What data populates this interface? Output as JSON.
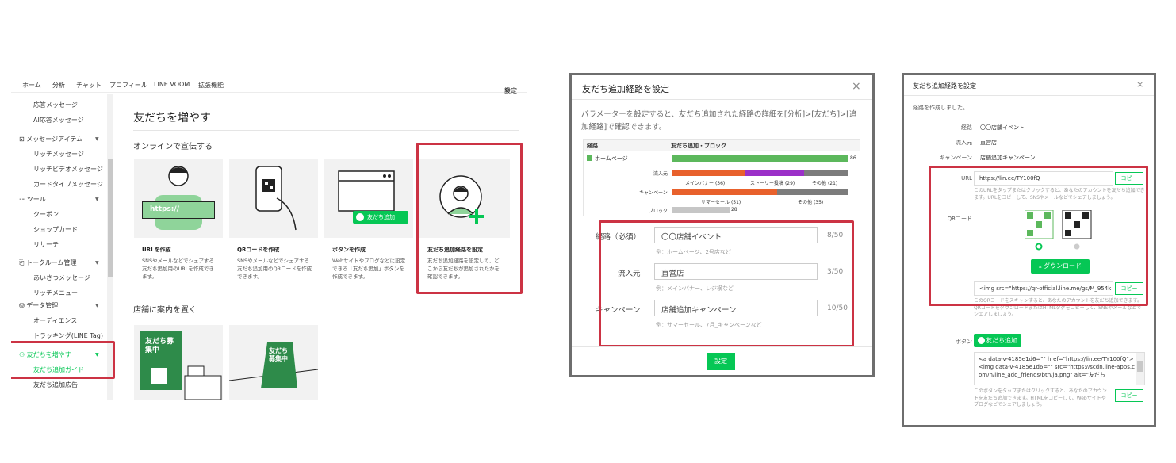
{
  "panel1": {
    "topnav": [
      "ホーム",
      "分析",
      "チャット",
      "プロフィール",
      "LINE VOOM",
      "拡張機能"
    ],
    "settings": "設定",
    "sidebar": {
      "items": [
        {
          "label": "応答メッセージ",
          "kind": "item"
        },
        {
          "label": "AI応答メッセージ",
          "kind": "item"
        },
        {
          "label": "メッセージアイテム",
          "kind": "group"
        },
        {
          "label": "リッチメッセージ",
          "kind": "item"
        },
        {
          "label": "リッチビデオメッセージ",
          "kind": "item"
        },
        {
          "label": "カードタイプメッセージ",
          "kind": "item"
        },
        {
          "label": "ツール",
          "kind": "group"
        },
        {
          "label": "クーポン",
          "kind": "item"
        },
        {
          "label": "ショップカード",
          "kind": "item"
        },
        {
          "label": "リサーチ",
          "kind": "item"
        },
        {
          "label": "トークルーム管理",
          "kind": "group"
        },
        {
          "label": "あいさつメッセージ",
          "kind": "item"
        },
        {
          "label": "リッチメニュー",
          "kind": "item"
        },
        {
          "label": "データ管理",
          "kind": "group"
        },
        {
          "label": "オーディエンス",
          "kind": "item"
        },
        {
          "label": "トラッキング(LINE Tag)",
          "kind": "item"
        },
        {
          "label": "友だちを増やす",
          "kind": "group-active"
        },
        {
          "label": "友だち追加ガイド",
          "kind": "item-active"
        },
        {
          "label": "友だち追加広告",
          "kind": "item"
        }
      ]
    },
    "page_title": "友だちを増やす",
    "section_online": "オンラインで宣伝する",
    "section_store": "店舗に案内を置く",
    "url_text": "https://",
    "add_friend_button": "友だち追加",
    "poster_text": "友だち募集中",
    "cards": [
      {
        "title": "URLを作成",
        "desc": "SNSやメールなどでシェアする友だち追加用のURLを作成できます。"
      },
      {
        "title": "QRコードを作成",
        "desc": "SNSやメールなどでシェアする友だち追加用のQRコードを作成できます。"
      },
      {
        "title": "ボタンを作成",
        "desc": "Webサイトやブログなどに設定できる「友だち追加」ボタンを作成できます。"
      },
      {
        "title": "友だち追加経路を設定",
        "desc": "友だち追加経路を設定して、どこから友だちが追加されたかを確認できます。"
      }
    ]
  },
  "panel2": {
    "title": "友だち追加経路を設定",
    "close_icon": "×",
    "description": "パラメーターを設定すると、友だち追加された経路の詳細を[分析]>[友だち]>[追加経路]で確認できます。",
    "chart_header": {
      "route": "経路",
      "metric": "友だち追加・ブロック"
    },
    "chart_rows": [
      {
        "label": "ホームページ",
        "value": "86"
      },
      {
        "label": "流入元",
        "segments": [
          {
            "name": "メインバナー",
            "value": "(36)"
          },
          {
            "name": "ストーリー投稿",
            "value": "(29)"
          },
          {
            "name": "その他",
            "value": "(21)"
          }
        ]
      },
      {
        "label": "キャンペーン",
        "segments": [
          {
            "name": "サマーセール",
            "value": "(51)"
          },
          {
            "name": "その他",
            "value": "(35)"
          }
        ]
      },
      {
        "label": "ブロック",
        "value": "28"
      }
    ],
    "colors": {
      "green": "#5cb85c",
      "orange": "#e8612c",
      "purple": "#9b30c8",
      "gray": "#7c7c7c",
      "lightgray": "#c6c6c6"
    },
    "fields": [
      {
        "label": "経路（必須）",
        "value": "〇〇店舗イベント",
        "count": "8/50",
        "example": "例：ホームページ、2号店など"
      },
      {
        "label": "流入元",
        "value": "直営店",
        "count": "3/50",
        "example": "例：メインバナー、レジ横など"
      },
      {
        "label": "キャンペーン",
        "value": "店舗追加キャンペーン",
        "count": "10/50",
        "example": "例：サマーセール、7月_キャンペーンなど"
      }
    ],
    "submit": "設定"
  },
  "panel3": {
    "title": "友だち追加経路を設定",
    "close_icon": "×",
    "created_msg": "経路を作成しました。",
    "rows": [
      {
        "label": "経路",
        "value": "〇〇店舗イベント"
      },
      {
        "label": "流入元",
        "value": "直営店"
      },
      {
        "label": "キャンペーン",
        "value": "店舗追加キャンペーン"
      }
    ],
    "url_label": "URL",
    "url_value": "https://lin.ee/TY100fQ",
    "copy": "コピー",
    "url_note": "このURLをタップまたはクリックすると、あなたのアカウントを友だち追加できます。URLをコピーして、SNSやメールなどでシェアしましょう。",
    "qr_label": "QRコード",
    "download": "ダウンロード",
    "qr_html": "<img src=\"https://qr-official.line.me/gs/M_954k",
    "qr_note": "このQRコードをスキャンすると、あなたのアカウントを友だち追加できます。QRコードをダウンロードまたはHTMLタグをコピーして、SNSやメールなどでシェアしましょう。",
    "button_label": "ボタン",
    "add_friend_button": "友だち追加",
    "code": "<a data-v-4185e1d6=\"\" href=\"https://lin.ee/TY100fQ\"><img data-v-4185e1d6=\"\" src=\"https://scdn.line-apps.com/n/line_add_friends/btn/ja.png\" alt=\"友だち",
    "button_note": "このボタンをタップまたはクリックすると、あなたのアカウントを友だち追加できます。HTMLをコピーして、Webサイトやブログなどでシェアしましょう。"
  }
}
